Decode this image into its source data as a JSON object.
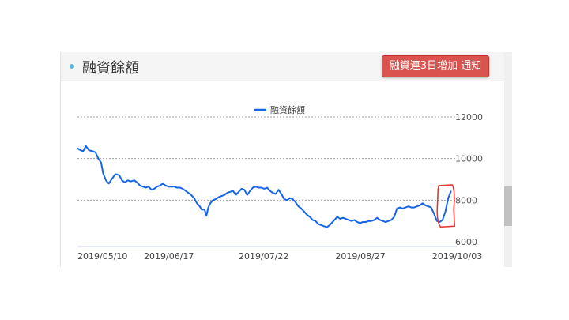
{
  "panel": {
    "title": "融資餘額",
    "notify_button": "融資連3日增加 通知"
  },
  "colors": {
    "series": "#1565e6",
    "annotation": "#e53935",
    "button": "#d9534f"
  },
  "chart_data": {
    "type": "line",
    "legend": "top-center",
    "series": [
      {
        "name": "融資餘額",
        "color": "#1565e6",
        "points": [
          [
            0,
            10500
          ],
          [
            3,
            10400
          ],
          [
            6,
            10350
          ],
          [
            9,
            10600
          ],
          [
            12,
            10400
          ],
          [
            16,
            10350
          ],
          [
            19,
            10300
          ],
          [
            22,
            10000
          ],
          [
            25,
            9800
          ],
          [
            27,
            9300
          ],
          [
            30,
            8950
          ],
          [
            33,
            8800
          ],
          [
            36,
            9000
          ],
          [
            40,
            9250
          ],
          [
            44,
            9200
          ],
          [
            47,
            8950
          ],
          [
            50,
            8850
          ],
          [
            53,
            8950
          ],
          [
            56,
            8900
          ],
          [
            60,
            8950
          ],
          [
            63,
            8850
          ],
          [
            66,
            8700
          ],
          [
            69,
            8650
          ],
          [
            72,
            8600
          ],
          [
            75,
            8650
          ],
          [
            78,
            8500
          ],
          [
            81,
            8550
          ],
          [
            84,
            8650
          ],
          [
            87,
            8700
          ],
          [
            90,
            8800
          ],
          [
            93,
            8700
          ],
          [
            96,
            8650
          ],
          [
            99,
            8650
          ],
          [
            102,
            8650
          ],
          [
            105,
            8600
          ],
          [
            108,
            8600
          ],
          [
            111,
            8550
          ],
          [
            114,
            8450
          ],
          [
            117,
            8350
          ],
          [
            120,
            8250
          ],
          [
            123,
            8100
          ],
          [
            126,
            7850
          ],
          [
            129,
            7700
          ],
          [
            131,
            7550
          ],
          [
            134,
            7550
          ],
          [
            136,
            7250
          ],
          [
            138,
            7650
          ],
          [
            140,
            7850
          ],
          [
            143,
            8000
          ],
          [
            146,
            8050
          ],
          [
            149,
            8150
          ],
          [
            152,
            8200
          ],
          [
            155,
            8250
          ],
          [
            158,
            8350
          ],
          [
            161,
            8400
          ],
          [
            164,
            8450
          ],
          [
            167,
            8250
          ],
          [
            170,
            8400
          ],
          [
            173,
            8550
          ],
          [
            176,
            8500
          ],
          [
            179,
            8250
          ],
          [
            182,
            8450
          ],
          [
            185,
            8600
          ],
          [
            188,
            8650
          ],
          [
            191,
            8600
          ],
          [
            194,
            8600
          ],
          [
            197,
            8550
          ],
          [
            200,
            8600
          ],
          [
            203,
            8450
          ],
          [
            206,
            8350
          ],
          [
            209,
            8300
          ],
          [
            212,
            8500
          ],
          [
            215,
            8300
          ],
          [
            218,
            8050
          ],
          [
            221,
            8000
          ],
          [
            224,
            8100
          ],
          [
            227,
            8050
          ],
          [
            230,
            7900
          ],
          [
            233,
            7700
          ],
          [
            236,
            7600
          ],
          [
            239,
            7450
          ],
          [
            242,
            7300
          ],
          [
            245,
            7200
          ],
          [
            248,
            7050
          ],
          [
            251,
            7000
          ],
          [
            254,
            6850
          ],
          [
            257,
            6800
          ],
          [
            260,
            6750
          ],
          [
            263,
            6700
          ],
          [
            266,
            6800
          ],
          [
            268,
            6900
          ],
          [
            271,
            7050
          ],
          [
            274,
            7200
          ],
          [
            277,
            7100
          ],
          [
            280,
            7150
          ],
          [
            283,
            7100
          ],
          [
            286,
            7050
          ],
          [
            289,
            7000
          ],
          [
            292,
            7050
          ],
          [
            295,
            6950
          ],
          [
            298,
            6900
          ],
          [
            301,
            6950
          ],
          [
            304,
            6950
          ],
          [
            307,
            7000
          ],
          [
            310,
            7000
          ],
          [
            313,
            7050
          ],
          [
            316,
            7150
          ],
          [
            319,
            7050
          ],
          [
            322,
            7000
          ],
          [
            325,
            6950
          ],
          [
            328,
            7000
          ],
          [
            331,
            7050
          ],
          [
            334,
            7200
          ],
          [
            337,
            7600
          ],
          [
            340,
            7650
          ],
          [
            343,
            7600
          ],
          [
            346,
            7650
          ],
          [
            349,
            7700
          ],
          [
            352,
            7650
          ],
          [
            355,
            7650
          ],
          [
            358,
            7700
          ],
          [
            361,
            7750
          ],
          [
            364,
            7850
          ],
          [
            367,
            7750
          ],
          [
            370,
            7700
          ],
          [
            373,
            7650
          ],
          [
            376,
            7350
          ],
          [
            379,
            7000
          ],
          [
            382,
            6950
          ],
          [
            385,
            7050
          ],
          [
            388,
            7450
          ],
          [
            391,
            8100
          ],
          [
            394,
            8450
          ]
        ]
      }
    ],
    "x_ticks": [
      {
        "x": 0,
        "label": "2019/05/10"
      },
      {
        "x": 70,
        "label": "2019/06/17"
      },
      {
        "x": 170,
        "label": "2019/07/22"
      },
      {
        "x": 272,
        "label": "2019/08/27"
      },
      {
        "x": 374,
        "label": "2019/10/03"
      }
    ],
    "y_ticks": [
      6000,
      8000,
      10000,
      12000
    ],
    "xlim": [
      0,
      400
    ],
    "ylim": [
      6000,
      12000
    ],
    "grid": "dashed-horizontal",
    "annotation": {
      "shape": "hand-drawn-rect",
      "color": "#e53935",
      "x_range": [
        382,
        396
      ],
      "y_range": [
        6900,
        8700
      ]
    }
  }
}
